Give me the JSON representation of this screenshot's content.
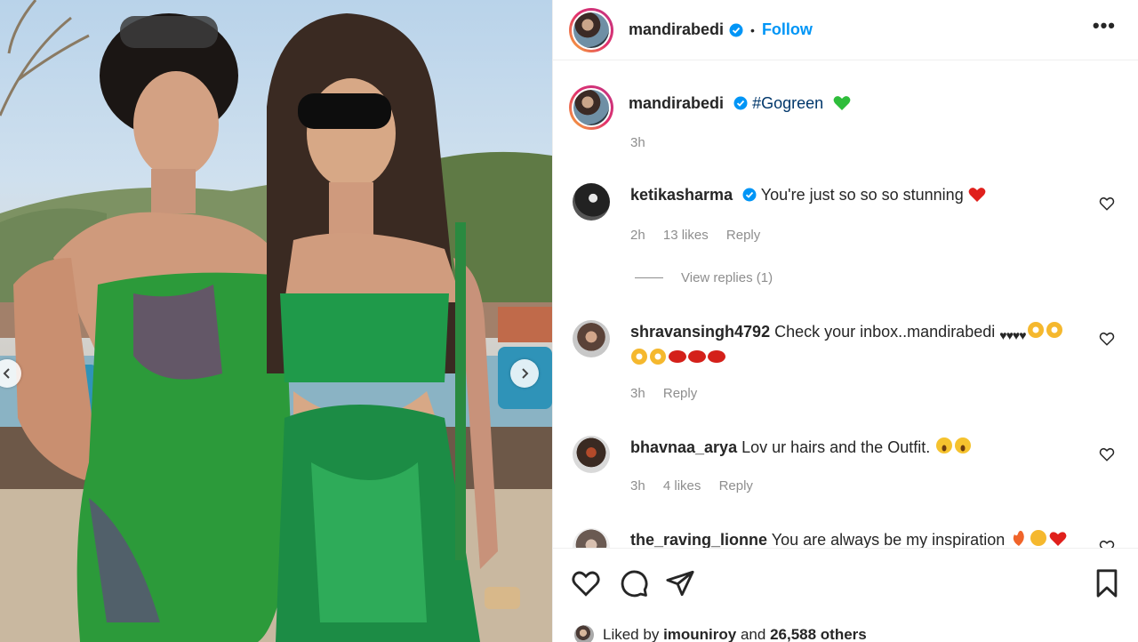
{
  "post": {
    "author": "mandirabedi",
    "follow_label": "Follow",
    "more_label": "•••",
    "separator": "•"
  },
  "caption": {
    "username": "mandirabedi",
    "hashtag": "#Gogreen",
    "time": "3h"
  },
  "comments": [
    {
      "username": "ketikasharma",
      "text": "You're just so so so stunning",
      "time": "2h",
      "likes": "13 likes",
      "reply": "Reply",
      "view_replies": "View replies (1)"
    },
    {
      "username": "shravansingh4792",
      "text": "Check your inbox..mandirabedi",
      "time": "3h",
      "reply": "Reply"
    },
    {
      "username": "bhavnaa_arya",
      "text": "Lov ur hairs and the Outfit.",
      "time": "3h",
      "likes": "4 likes",
      "reply": "Reply"
    },
    {
      "username": "the_raving_lionne",
      "text": "You are always be my inspiration"
    }
  ],
  "likes": {
    "prefix": "Liked by",
    "user": "imouniroy",
    "and": "and",
    "others": "26,588 others"
  },
  "icons": [
    "verified-badge-icon",
    "heart-icon",
    "comment-icon",
    "share-icon",
    "bookmark-icon",
    "chevron-left-icon",
    "chevron-right-icon"
  ],
  "colors": {
    "follow": "#0095f6",
    "hashtag": "#00376b",
    "meta": "#8e8e8e",
    "verified": "#0095f6"
  }
}
